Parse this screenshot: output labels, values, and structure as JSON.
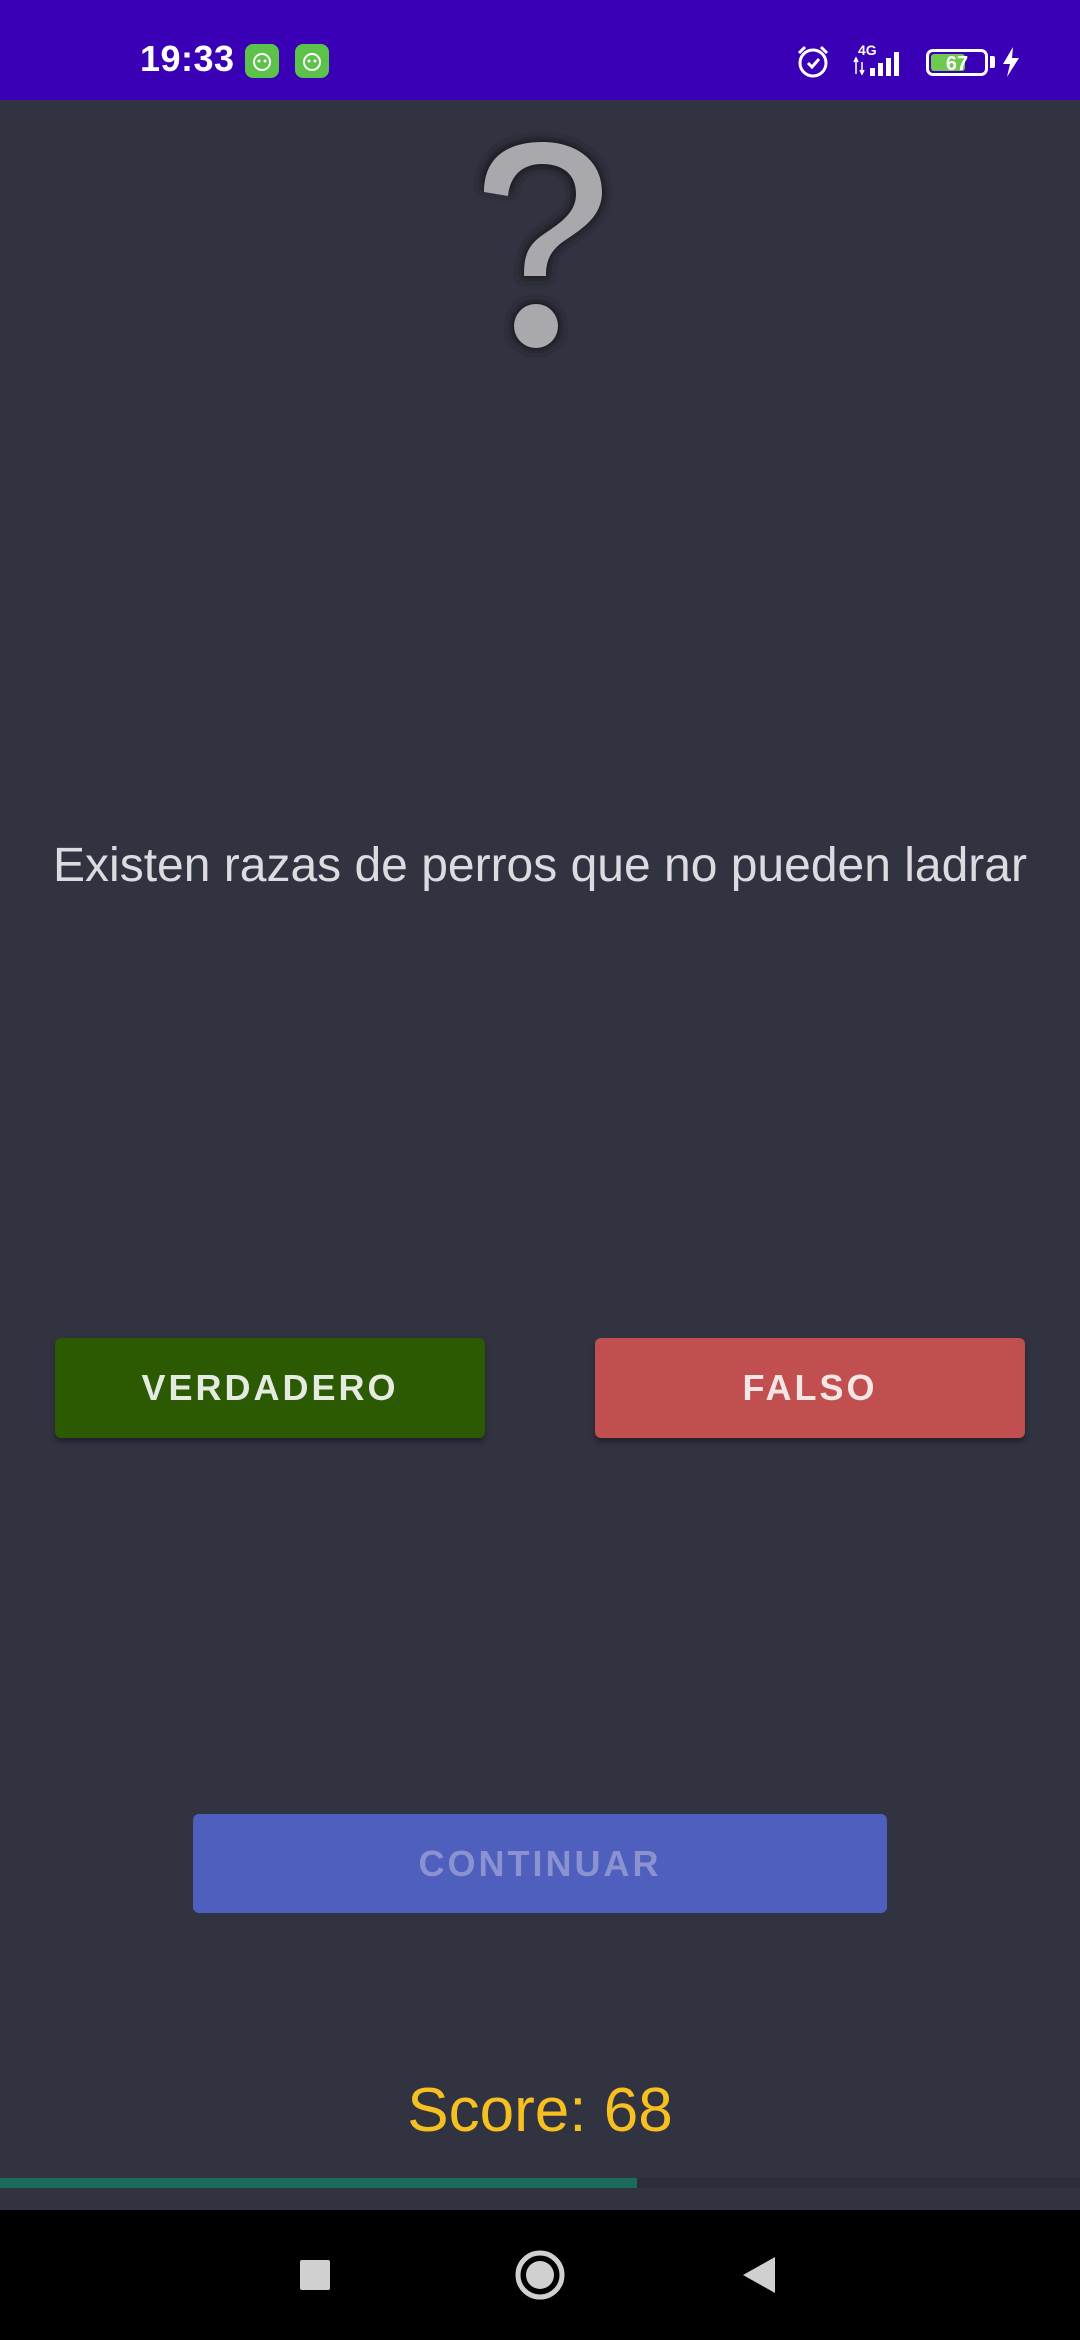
{
  "status_bar": {
    "time": "19:33",
    "network_label": "4G",
    "battery_level": "67",
    "battery_fraction": 0.67,
    "icons": [
      "notification-app-icon",
      "notification-app-icon",
      "alarm-icon",
      "signal-icon",
      "battery-icon",
      "charging-icon"
    ]
  },
  "question": {
    "icon": "question-mark-icon",
    "text": "Existen razas de perros que no pueden ladrar"
  },
  "answers": {
    "true_label": "VERDADERO",
    "false_label": "FALSO",
    "true_color": "#2b5a02",
    "false_color": "#c24f4f"
  },
  "continue": {
    "label": "CONTINUAR",
    "color": "#4f5fbe"
  },
  "score": {
    "text": "Score: 68",
    "color": "#f5c020"
  },
  "progress": {
    "fraction": 0.59,
    "color": "#1b6b5a"
  },
  "nav": {
    "icons": [
      "recents-square-icon",
      "home-circle-icon",
      "back-triangle-icon"
    ]
  }
}
